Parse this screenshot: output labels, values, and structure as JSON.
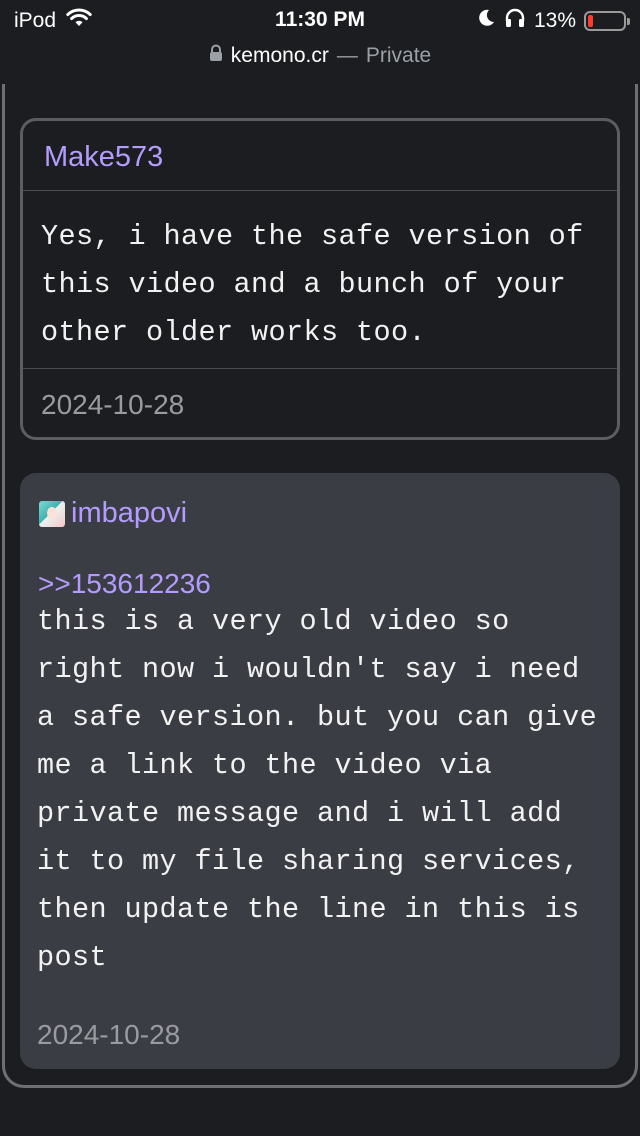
{
  "status_bar": {
    "carrier": "iPod",
    "time": "11:30 PM",
    "battery_percent": "13%",
    "icons": [
      "wifi-icon",
      "moon-icon",
      "headphones-icon",
      "battery-icon"
    ]
  },
  "url_bar": {
    "domain": "kemono.cr",
    "separator": "—",
    "mode": "Private"
  },
  "comments": [
    {
      "author": "Make573",
      "text": "Yes, i have the safe version of this video and a bunch of your other older works too.",
      "date": "2024-10-28"
    },
    {
      "author": "imbapovi",
      "reply_to": ">>153612236",
      "text": "this is a very old video so right now i wouldn't say i need a safe version. but you can give me a link to the video via private message and i will add it to my file sharing services, then update the line in this is post",
      "date": "2024-10-28"
    }
  ],
  "colors": {
    "background": "#1c1d20",
    "accent_username": "#b49cff",
    "reply_card": "#3b3d44",
    "battery_low": "#ff3b30"
  }
}
